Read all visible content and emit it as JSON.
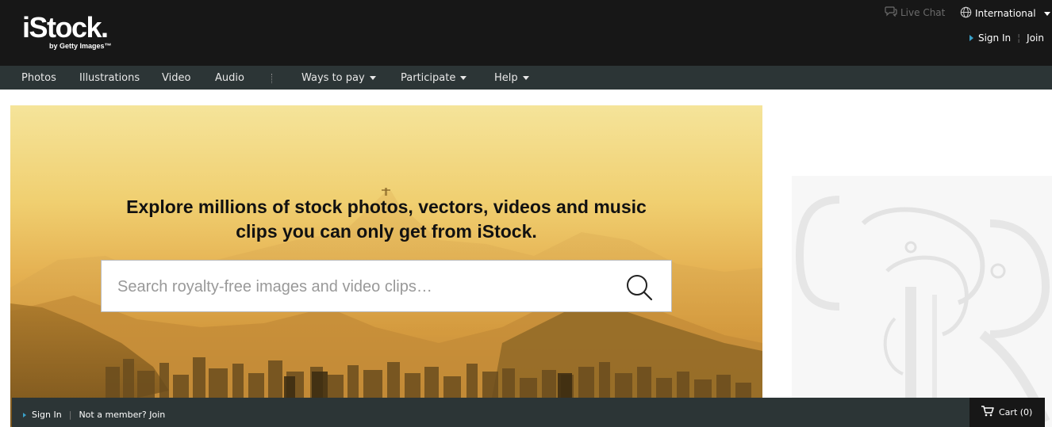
{
  "brand": {
    "name": "iStock.",
    "tagline": "by Getty Images™"
  },
  "utility": {
    "live_chat": "Live Chat",
    "international": "International",
    "sign_in": "Sign In",
    "join": "Join"
  },
  "nav": {
    "items": [
      {
        "label": "Photos",
        "dropdown": false
      },
      {
        "label": "Illustrations",
        "dropdown": false
      },
      {
        "label": "Video",
        "dropdown": false
      },
      {
        "label": "Audio",
        "dropdown": false
      },
      {
        "label": "Ways to pay",
        "dropdown": true
      },
      {
        "label": "Participate",
        "dropdown": true
      },
      {
        "label": "Help",
        "dropdown": true
      }
    ]
  },
  "hero": {
    "headline": "Explore millions of stock photos, vectors, videos and music clips you can only get from iStock.",
    "search_placeholder": "Search royalty-free images and video clips…",
    "search_value": ""
  },
  "footer_bar": {
    "sign_in": "Sign In",
    "not_member": "Not a member? Join",
    "cart": "Cart (0)"
  },
  "colors": {
    "topbar": "#171717",
    "navbar": "#2c3536",
    "accent": "#3aa0c8"
  }
}
